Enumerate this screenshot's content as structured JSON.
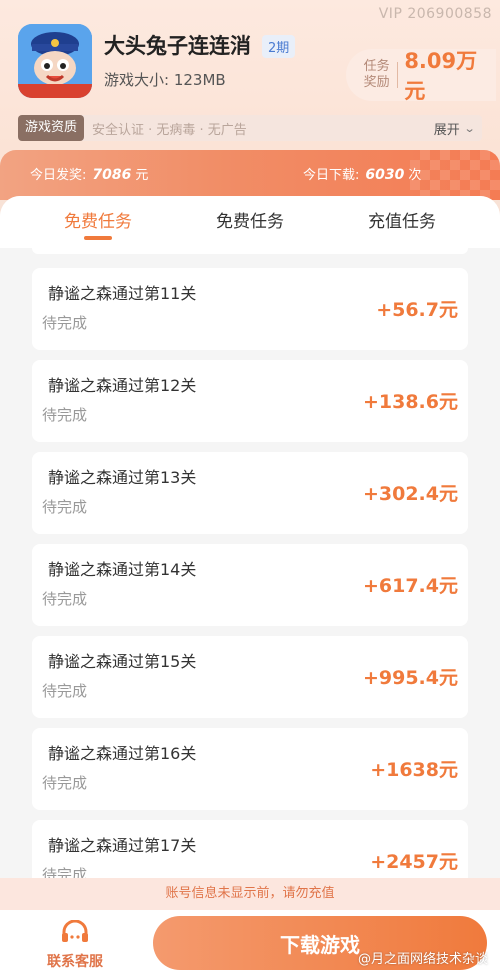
{
  "vip_id": "VIP 206900858",
  "game": {
    "title": "大头兔子连连消",
    "period_badge": "2期",
    "size_label": "游戏大小:",
    "size_value": "123MB",
    "icon": "game-app-icon"
  },
  "reward": {
    "label": "任务奖励",
    "amount": "8.09万元"
  },
  "info_bar": {
    "tag": "游戏资质",
    "text": "安全认证 · 无病毒 · 无广告",
    "expand_label": "展开"
  },
  "stats": {
    "today_awarded_label": "今日发奖:",
    "today_awarded_value": "7086",
    "today_awarded_unit": "元",
    "today_downloads_label": "今日下载:",
    "today_downloads_value": "6030",
    "today_downloads_unit": "次"
  },
  "tabs": [
    {
      "label": "免费任务",
      "active": true
    },
    {
      "label": "免费任务",
      "active": false
    },
    {
      "label": "充值任务",
      "active": false
    }
  ],
  "tasks": [
    {
      "name": "静谧之森通过第11关",
      "status": "待完成",
      "reward": "+56.7元"
    },
    {
      "name": "静谧之森通过第12关",
      "status": "待完成",
      "reward": "+138.6元"
    },
    {
      "name": "静谧之森通过第13关",
      "status": "待完成",
      "reward": "+302.4元"
    },
    {
      "name": "静谧之森通过第14关",
      "status": "待完成",
      "reward": "+617.4元"
    },
    {
      "name": "静谧之森通过第15关",
      "status": "待完成",
      "reward": "+995.4元"
    },
    {
      "name": "静谧之森通过第16关",
      "status": "待完成",
      "reward": "+1638元"
    },
    {
      "name": "静谧之森通过第17关",
      "status": "待完成",
      "reward": "+2457元"
    }
  ],
  "warning": "账号信息未显示前，请勿充值",
  "bottom": {
    "customer_service_label": "联系客服",
    "download_label": "下载游戏"
  },
  "watermark": "@月之面网络技术杂谈",
  "colors": {
    "accent": "#f07a3c",
    "muted": "#999999"
  }
}
